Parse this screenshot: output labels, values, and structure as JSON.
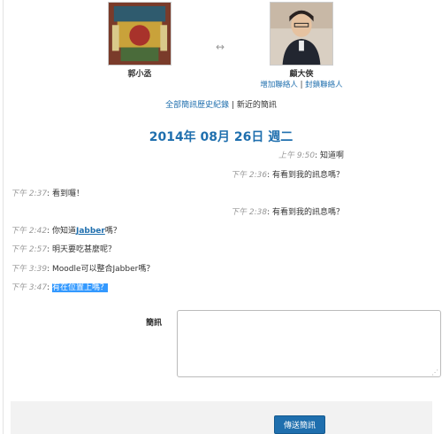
{
  "participants": {
    "left": {
      "name": "郭小丞"
    },
    "right": {
      "name": "顧大俠",
      "add_contact": "增加聯絡人",
      "separator": "|",
      "block_contact": "封鎖聯絡人"
    }
  },
  "history": {
    "all_label": "全部簡訊歷史紀錄",
    "separator": "|",
    "recent_label": "新近的簡訊"
  },
  "date_heading": "2014年 08月 26日 週二",
  "messages": [
    {
      "time": "上午 9:50",
      "text": "知道啊"
    },
    {
      "time": "下午 2:36",
      "text": "有看到我的訊息嗎？"
    },
    {
      "time": "下午 2:37",
      "text": "看到囉！"
    },
    {
      "time": "下午 2:38",
      "text": "有看到我的訊息嗎？"
    },
    {
      "time": "下午 2:42",
      "text_before": "你知道",
      "link": "Jabber",
      "text_after": "嗎？"
    },
    {
      "time": "下午 2:57",
      "text": "明天要吃甚麼呢？"
    },
    {
      "time": "下午 3:39",
      "text": "Moodle可以整合Jabber嗎？"
    },
    {
      "time": "下午 3:47",
      "text": "有在位置上嗎？"
    }
  ],
  "compose": {
    "label": "簡訊",
    "value": "",
    "send_label": "傳送簡訊"
  },
  "colors": {
    "link": "#1f6fae",
    "time": "#999999",
    "button": "#1f6fae",
    "highlight": "#3399ff"
  }
}
